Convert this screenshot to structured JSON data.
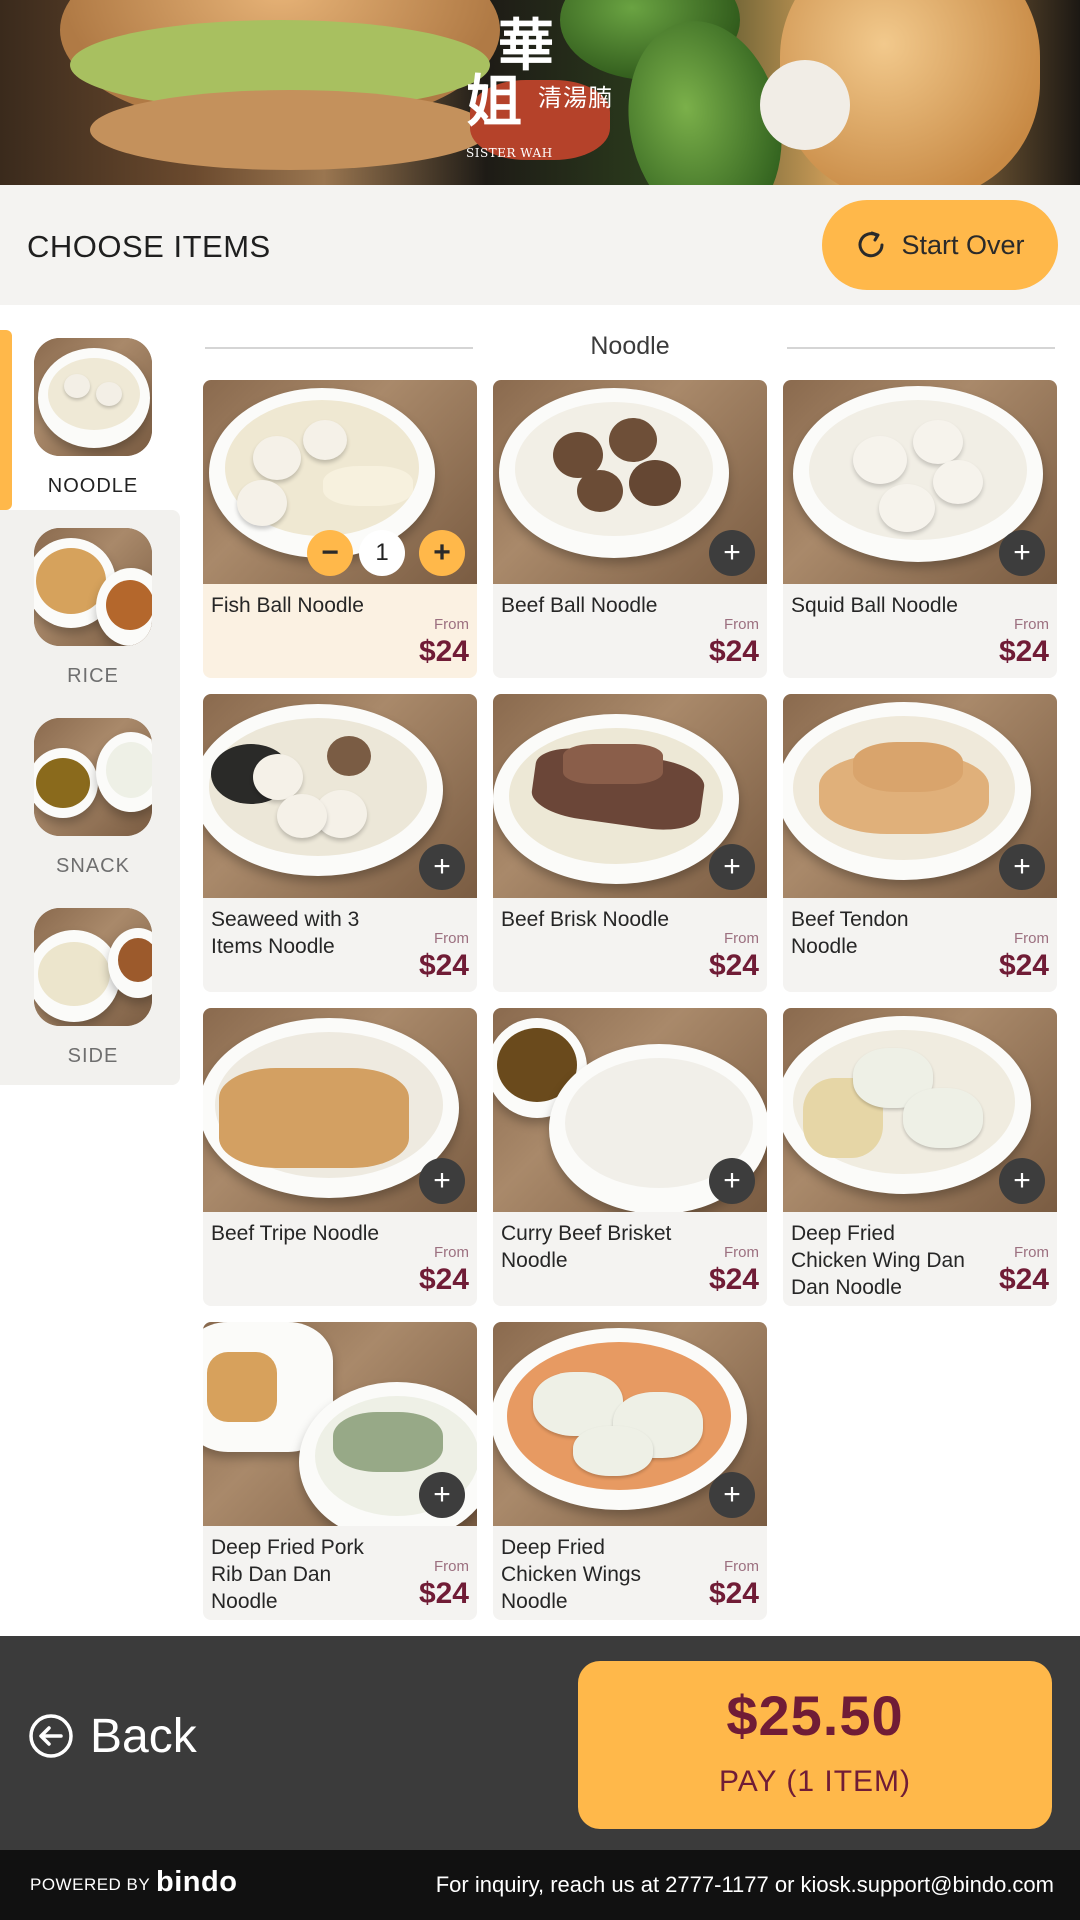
{
  "brand": {
    "logo_chars_1": "華",
    "logo_chars_2": "姐",
    "logo_sub": "清湯腩",
    "logo_en": "SISTER WAH"
  },
  "header": {
    "title": "CHOOSE ITEMS",
    "start_over_label": "Start Over"
  },
  "categories": [
    {
      "label": "NOODLE",
      "active": true
    },
    {
      "label": "RICE",
      "active": false
    },
    {
      "label": "SNACK",
      "active": false
    },
    {
      "label": "SIDE",
      "active": false
    }
  ],
  "section": {
    "title": "Noodle"
  },
  "items": [
    {
      "name": "Fish Ball Noodle",
      "from": "From",
      "price": "$24",
      "quantity": "1",
      "selected": true
    },
    {
      "name": "Beef Ball Noodle",
      "from": "From",
      "price": "$24"
    },
    {
      "name": "Squid Ball Noodle",
      "from": "From",
      "price": "$24"
    },
    {
      "name": "Seaweed with 3 Items Noodle",
      "from": "From",
      "price": "$24"
    },
    {
      "name": "Beef Brisk Noodle",
      "from": "From",
      "price": "$24"
    },
    {
      "name": "Beef Tendon Noodle",
      "from": "From",
      "price": "$24"
    },
    {
      "name": "Beef Tripe Noodle",
      "from": "From",
      "price": "$24"
    },
    {
      "name": "Curry Beef Brisket Noodle",
      "from": "From",
      "price": "$24"
    },
    {
      "name": "Deep Fried Chicken Wing Dan Dan Noodle",
      "from": "From",
      "price": "$24"
    },
    {
      "name": "Deep Fried Pork Rib Dan Dan Noodle",
      "from": "From",
      "price": "$24"
    },
    {
      "name": "Deep Fried Chicken Wings Noodle",
      "from": "From",
      "price": "$24"
    }
  ],
  "controls": {
    "minus": "−",
    "plus": "+"
  },
  "bottom": {
    "back_label": "Back",
    "total": "$25.50",
    "pay_label": "PAY (1 ITEM)"
  },
  "footer": {
    "powered_by": "POWERED BY",
    "brand": "bindo",
    "inquiry": "For inquiry, reach us at 2777-1177 or  kiosk.support@bindo.com"
  },
  "colors": {
    "accent": "#ffb84a",
    "price": "#701c36",
    "bar": "#3b3b3b",
    "footer": "#111111"
  },
  "icons": {
    "start_over": "refresh-icon",
    "back": "arrow-left-circle-icon",
    "add": "plus-icon",
    "remove": "minus-icon"
  }
}
